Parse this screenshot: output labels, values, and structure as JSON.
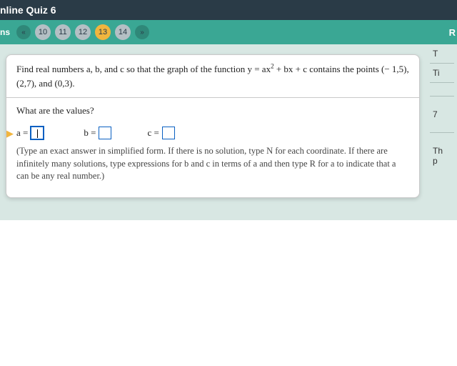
{
  "header": {
    "title": "nline Quiz 6"
  },
  "nav": {
    "left_label": "ns",
    "prev_icon": "«",
    "next_icon": "»",
    "items": [
      "10",
      "11",
      "12",
      "13",
      "14"
    ],
    "active_index": 3,
    "right_label": "R"
  },
  "question": {
    "prompt_prefix": "Find real numbers a, b, and c so that the graph of the function y = ax",
    "prompt_exp": "2",
    "prompt_mid": " + bx + c contains the points (",
    "point1": "− 1,5",
    "sep1": "),  (",
    "point2": "2,7",
    "sep2": "), and (",
    "point3": "0,3",
    "prompt_end": ")."
  },
  "answer": {
    "heading": "What are the values?",
    "labels": {
      "a": "a =",
      "b": "b =",
      "c": "c ="
    },
    "values": {
      "a": "",
      "b": "",
      "c": ""
    },
    "hint": "(Type an exact answer in simplified form.  If there is no solution, type N for each coordinate.  If there are infinitely many solutions, type expressions for b and c in terms of a and then type R for a to indicate that a can be any real number.)"
  },
  "side": {
    "f1": "T",
    "f2": "Ti",
    "f3": "7",
    "f4a": "Th",
    "f4b": "p"
  }
}
